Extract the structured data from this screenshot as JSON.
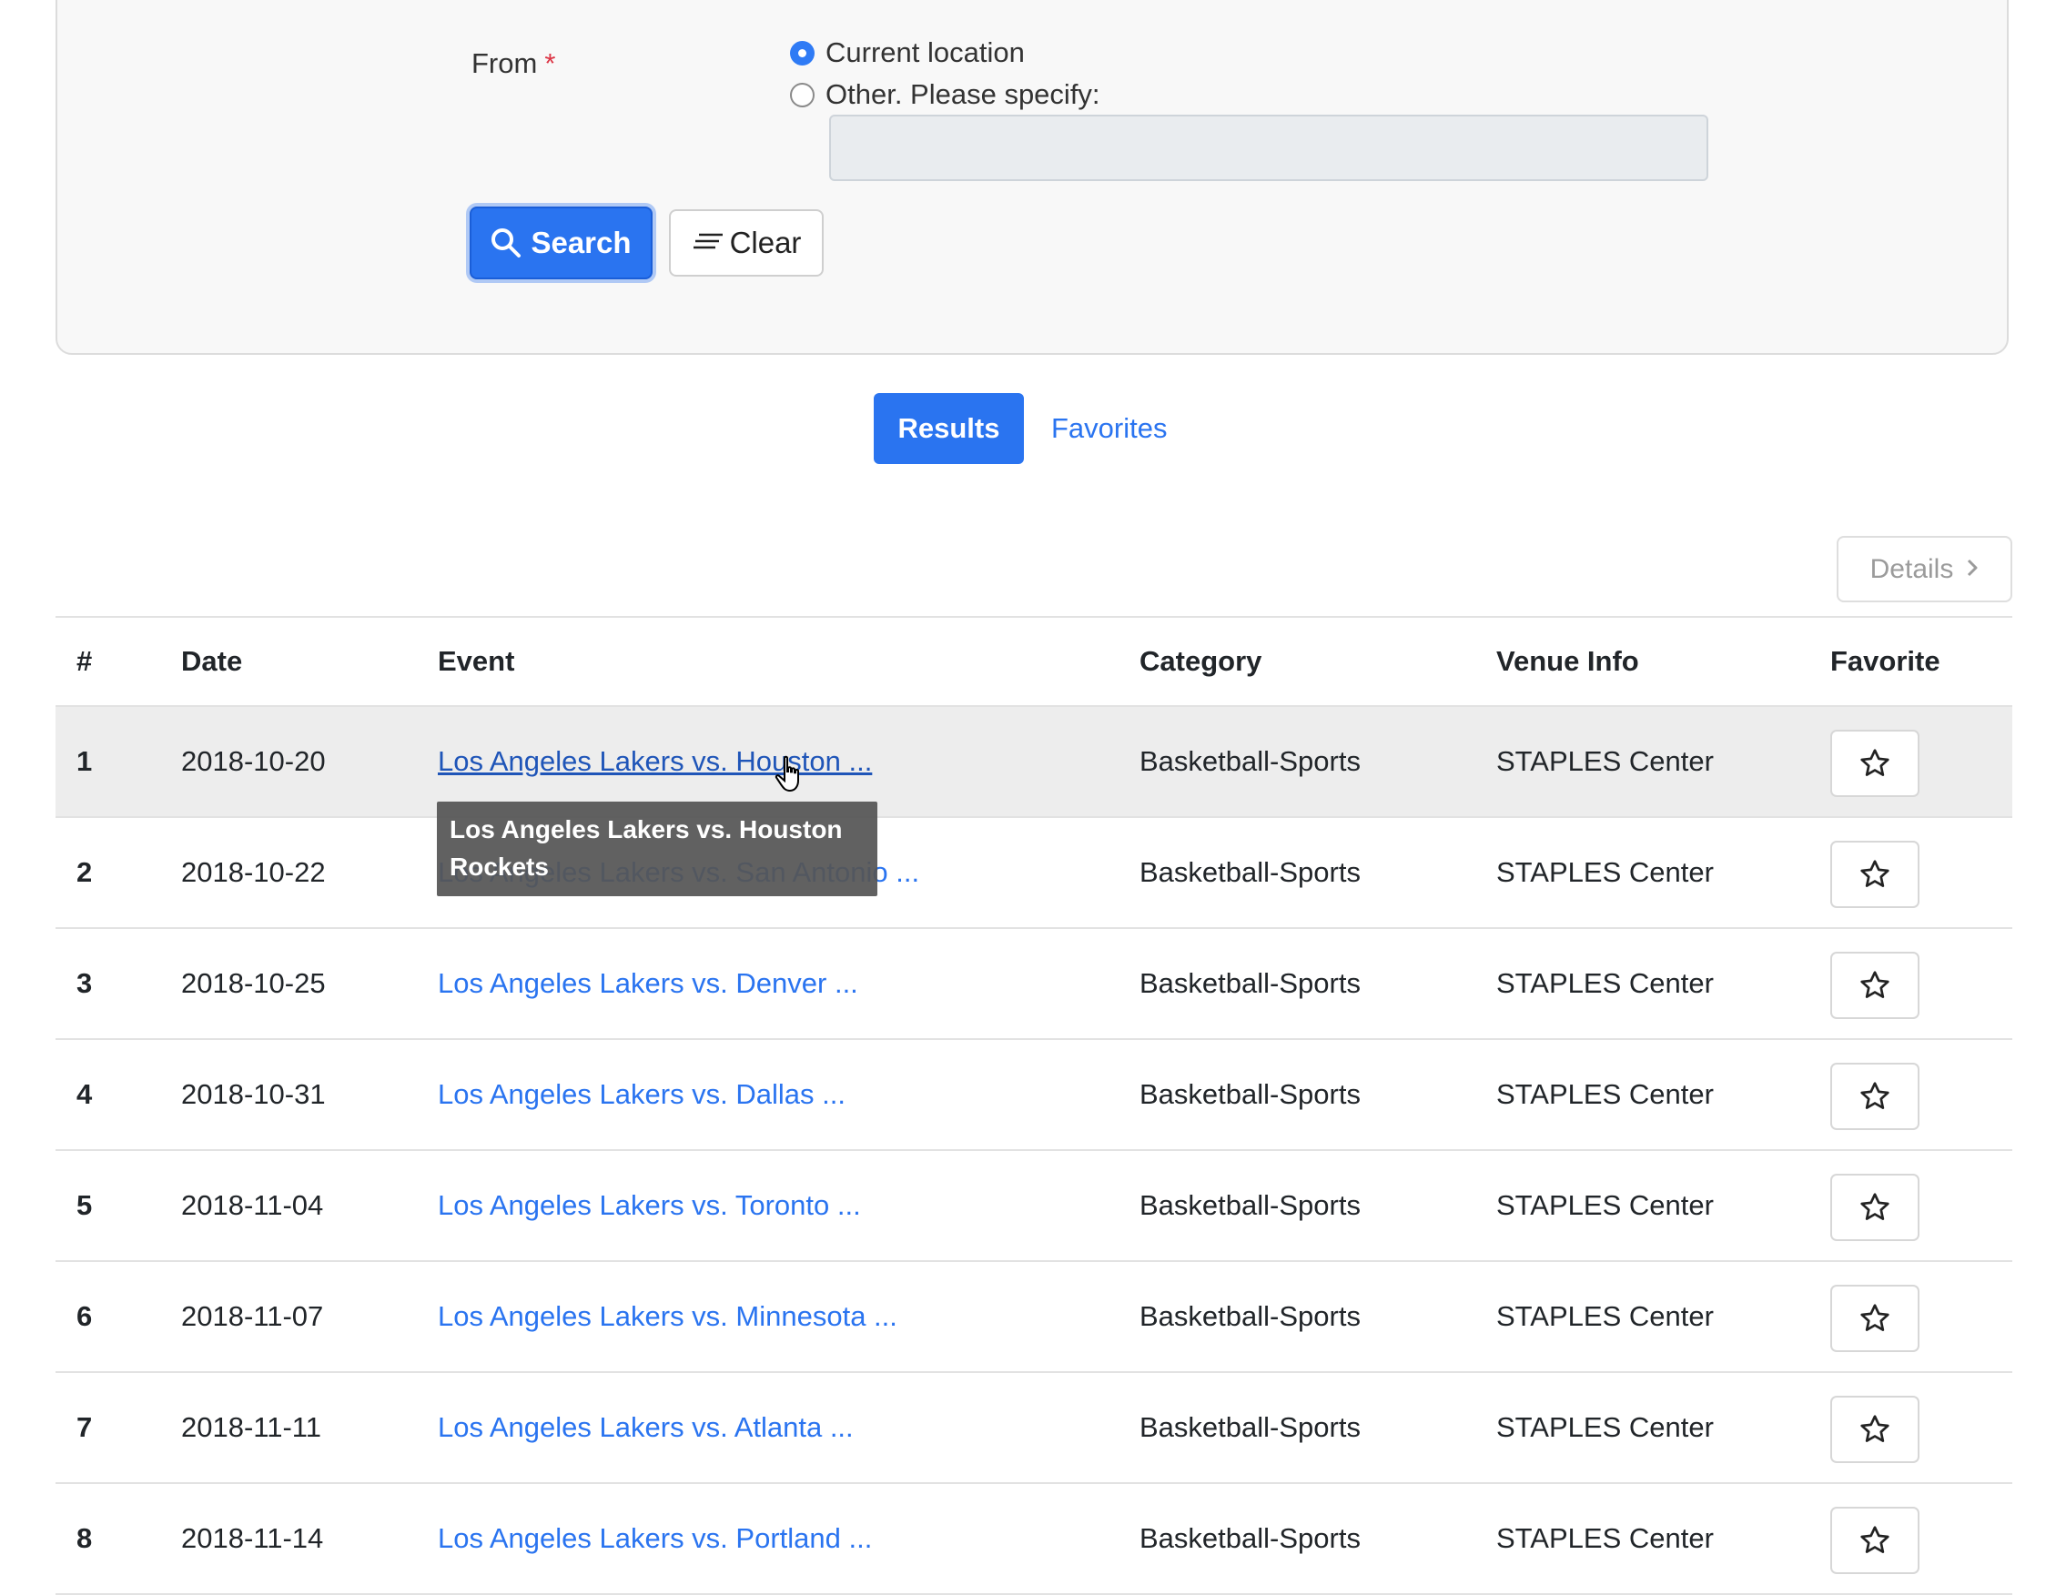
{
  "form": {
    "from_label": "From",
    "required_mark": "*",
    "options": [
      {
        "label": "Current location",
        "checked": true
      },
      {
        "label": "Other. Please specify:",
        "checked": false
      }
    ],
    "other_location_value": "",
    "search_label": "Search",
    "clear_label": "Clear"
  },
  "tabs": [
    {
      "label": "Results",
      "active": true
    },
    {
      "label": "Favorites",
      "active": false
    }
  ],
  "details_label": "Details",
  "table": {
    "headers": [
      "#",
      "Date",
      "Event",
      "Category",
      "Venue Info",
      "Favorite"
    ],
    "rows": [
      {
        "num": "1",
        "date": "2018-10-20",
        "event": "Los Angeles Lakers vs. Houston ...",
        "category": "Basketball-Sports",
        "venue": "STAPLES Center"
      },
      {
        "num": "2",
        "date": "2018-10-22",
        "event": "Los Angeles Lakers vs. San Antonio ...",
        "category": "Basketball-Sports",
        "venue": "STAPLES Center"
      },
      {
        "num": "3",
        "date": "2018-10-25",
        "event": "Los Angeles Lakers vs. Denver ...",
        "category": "Basketball-Sports",
        "venue": "STAPLES Center"
      },
      {
        "num": "4",
        "date": "2018-10-31",
        "event": "Los Angeles Lakers vs. Dallas ...",
        "category": "Basketball-Sports",
        "venue": "STAPLES Center"
      },
      {
        "num": "5",
        "date": "2018-11-04",
        "event": "Los Angeles Lakers vs. Toronto ...",
        "category": "Basketball-Sports",
        "venue": "STAPLES Center"
      },
      {
        "num": "6",
        "date": "2018-11-07",
        "event": "Los Angeles Lakers vs. Minnesota ...",
        "category": "Basketball-Sports",
        "venue": "STAPLES Center"
      },
      {
        "num": "7",
        "date": "2018-11-11",
        "event": "Los Angeles Lakers vs. Atlanta ...",
        "category": "Basketball-Sports",
        "venue": "STAPLES Center"
      },
      {
        "num": "8",
        "date": "2018-11-14",
        "event": "Los Angeles Lakers vs. Portland ...",
        "category": "Basketball-Sports",
        "venue": "STAPLES Center"
      }
    ]
  },
  "tooltip": {
    "line1": "Los Angeles Lakers vs. Houston",
    "line2": "Rockets"
  },
  "colors": {
    "accent": "#2a74f0",
    "required": "#dc3545",
    "tooltip_bg": "#555555"
  }
}
